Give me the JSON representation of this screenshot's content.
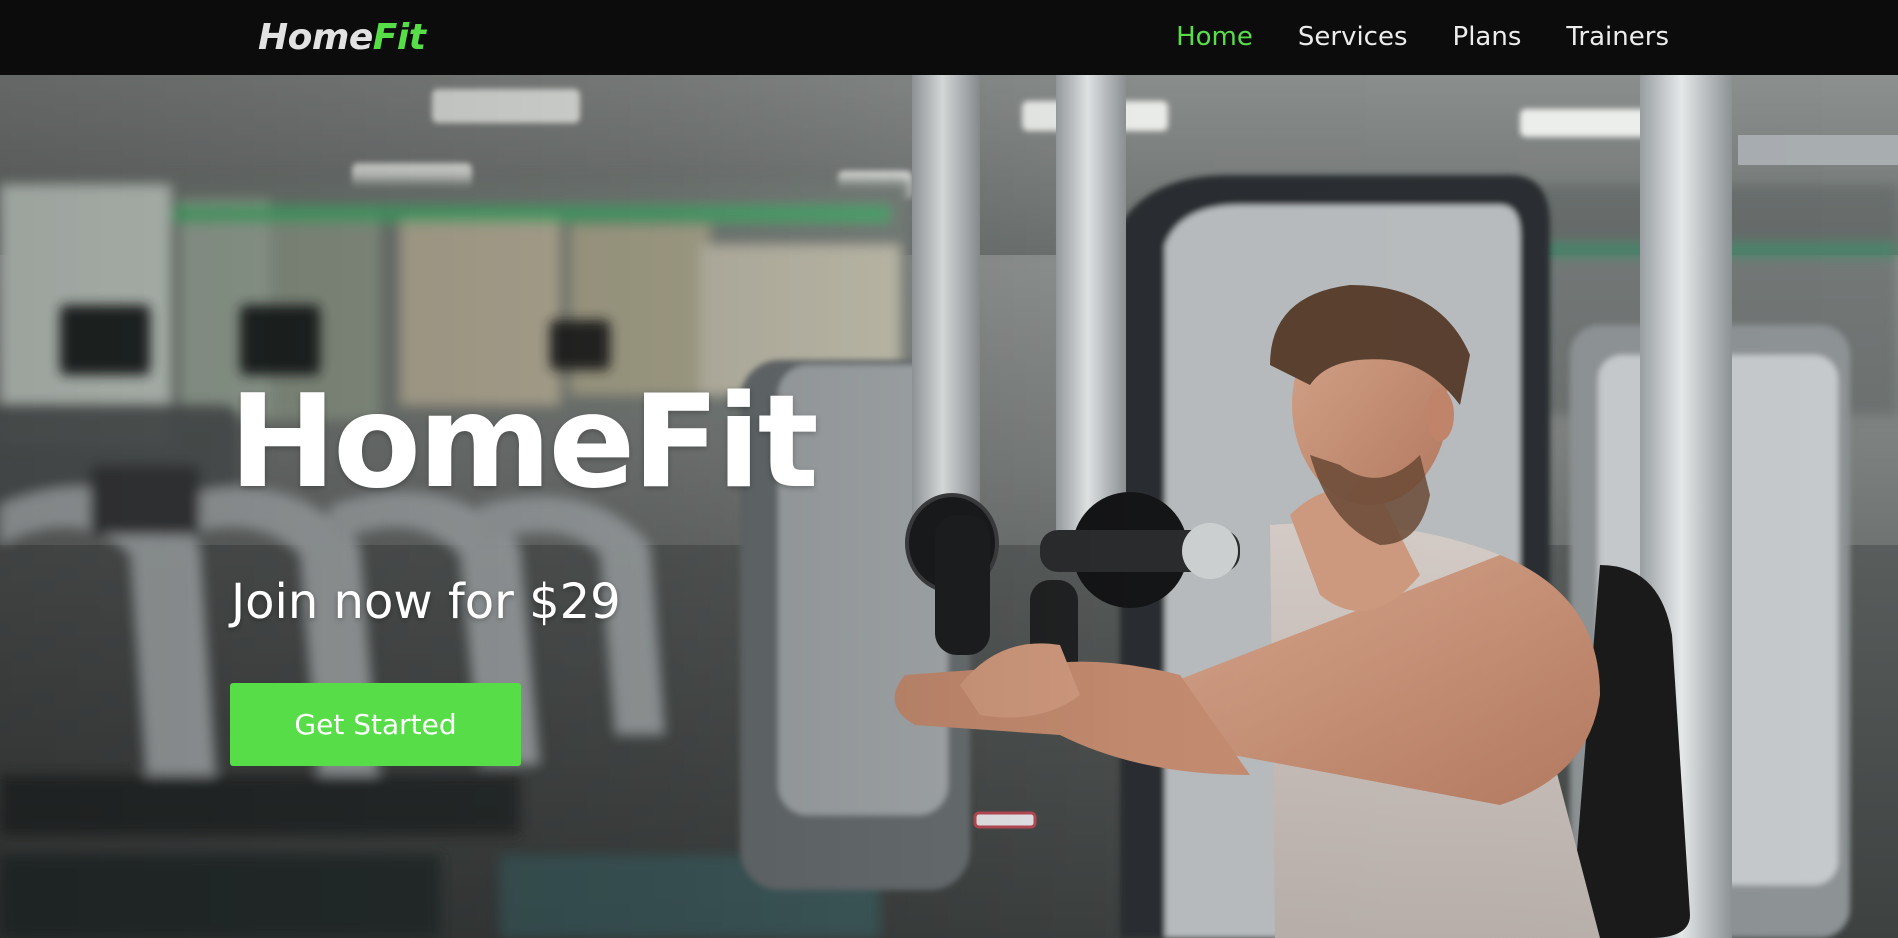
{
  "navbar": {
    "logo": {
      "part_a": "Home",
      "part_b": "Fit"
    },
    "links": [
      {
        "label": "Home",
        "active": true
      },
      {
        "label": "Services",
        "active": false
      },
      {
        "label": "Plans",
        "active": false
      },
      {
        "label": "Trainers",
        "active": false
      }
    ]
  },
  "hero": {
    "title": "HomeFit",
    "subtitle": "Join now for $29",
    "cta_label": "Get Started",
    "background_image": "man-using-chest-press-machine-in-gym-photo"
  },
  "colors": {
    "accent": "#57dd47",
    "navbar_bg": "#0c0c0c",
    "nav_text": "#ececec",
    "hero_text": "#ffffff"
  }
}
